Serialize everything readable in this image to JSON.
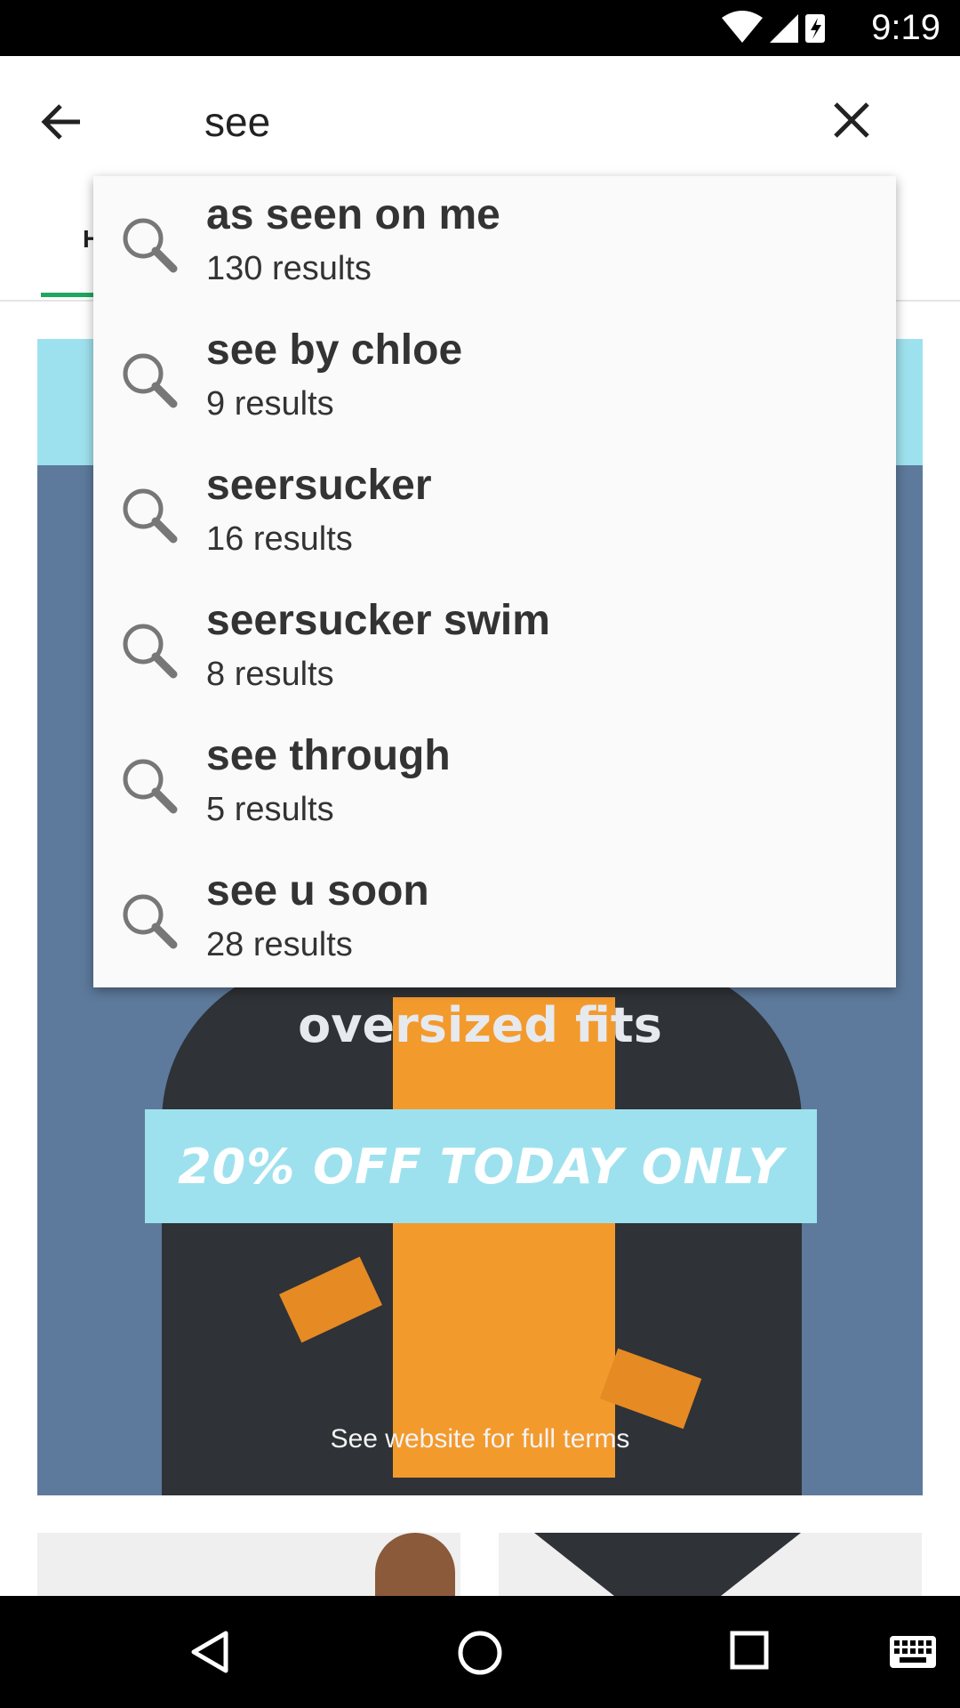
{
  "status_bar": {
    "time": "9:19",
    "icons": [
      "wifi-icon",
      "signal-icon",
      "battery-charging-icon"
    ]
  },
  "search": {
    "query": "see",
    "back_icon": "arrow-back-icon",
    "clear_icon": "close-icon"
  },
  "tabs": {
    "partial_label": "H",
    "accent_color": "#1fa761"
  },
  "suggestions": [
    {
      "title": "as seen on me",
      "count": "130 results"
    },
    {
      "title": "see by chloe",
      "count": "9 results"
    },
    {
      "title": "seersucker",
      "count": "16 results"
    },
    {
      "title": "seersucker swim",
      "count": "8 results"
    },
    {
      "title": "see through",
      "count": "5 results"
    },
    {
      "title": "see u soon",
      "count": "28 results"
    }
  ],
  "hero": {
    "headline": "oversized fits",
    "promo": "20% OFF TODAY ONLY",
    "terms": "See website for full terms",
    "colors": {
      "banner": "#9ee1ee",
      "background": "#5d7a9c"
    }
  },
  "nav_bar": {
    "icons": [
      "back-triangle-icon",
      "home-circle-icon",
      "recents-square-icon",
      "keyboard-icon"
    ]
  }
}
